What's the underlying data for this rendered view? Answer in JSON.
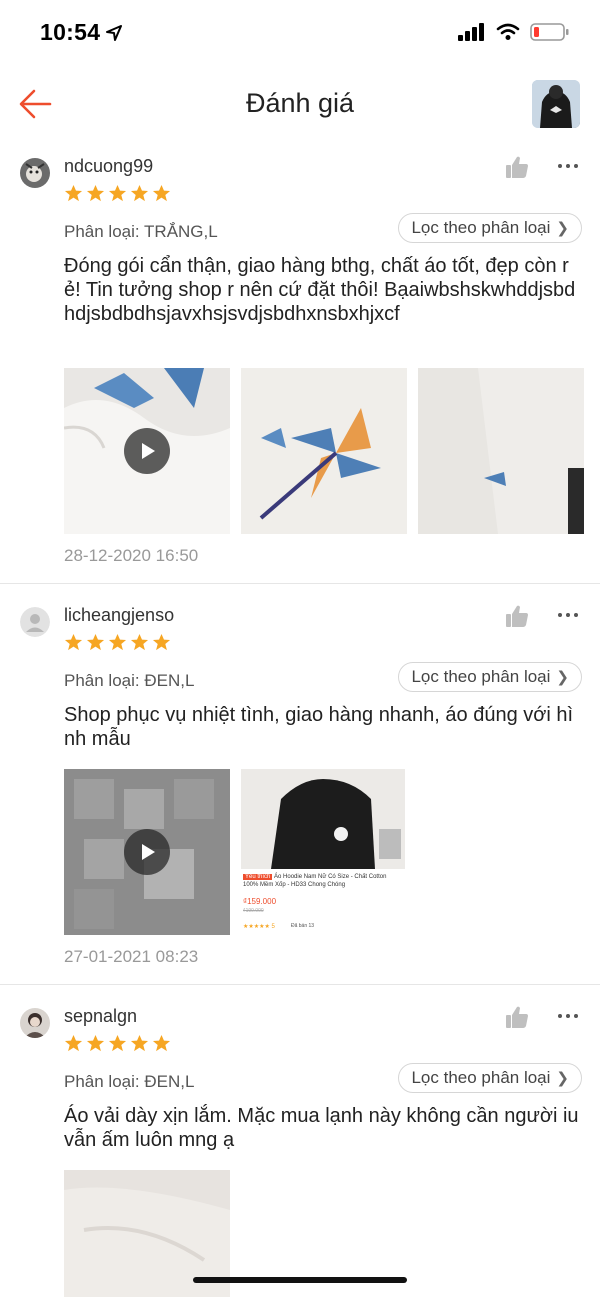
{
  "status": {
    "time": "10:54"
  },
  "header": {
    "title": "Đánh giá"
  },
  "reviews": [
    {
      "username": "ndcuong99",
      "stars": 5,
      "variant": "Phân loại: TRẮNG,L",
      "filter_label": "Lọc theo phân loại",
      "comment": "Đóng gói cẩn thận, giao hàng bthg, chất áo tốt, đẹp còn rẻ! Tin tưởng shop r nên cứ đặt thôi! Bạaiwbshskwhddjsbdhdjsbdbdhsjavxhsjsvdjsbdhxnsbxhjxcf",
      "date": "28-12-2020 16:50"
    },
    {
      "username": "licheangjenso",
      "stars": 5,
      "variant": "Phân loại: ĐEN,L",
      "filter_label": "Lọc theo phân loại",
      "comment": "Shop phục vụ nhiệt tình, giao hàng nhanh, áo đúng với hình mẫu",
      "date": "27-01-2021 08:23",
      "product_card": {
        "tag": "Yêu thích",
        "name": "Áo Hoodie Nam Nữ Có Size - Chất Cotton 100% Mềm Xốp - HD33 Chong Chóng",
        "price": "₫159.000",
        "old_price": "₫199.000",
        "rating": "★★★★★ 5",
        "sold": "Đã bán 13"
      }
    },
    {
      "username": "sepnalgn",
      "stars": 5,
      "variant": "Phân loại: ĐEN,L",
      "filter_label": "Lọc theo phân loại",
      "comment": "Áo vải dày xịn lắm. Mặc mua lạnh này không cần người iu vẫn ấm luôn mng ạ",
      "date": ""
    }
  ],
  "colors": {
    "accent": "#ee4d2d",
    "star": "#f6a623",
    "text": "#222222",
    "muted": "#999999"
  }
}
